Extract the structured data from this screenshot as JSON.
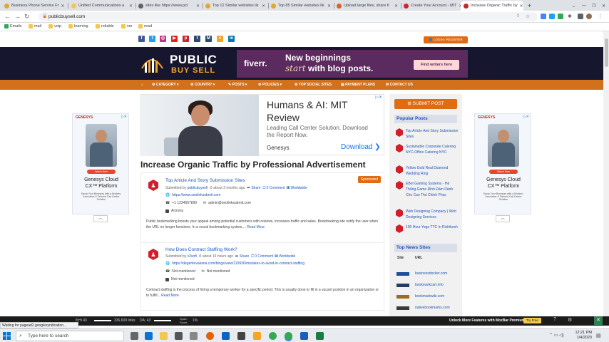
{
  "browser": {
    "tabs": [
      {
        "label": "Business Phone Service Fr",
        "color": "#e4a72b"
      },
      {
        "label": "Unified Communications a",
        "color": "#f6c64c"
      },
      {
        "label": "sites like https://www.pcl",
        "color": "#5f6368"
      },
      {
        "label": "Top 12 Similar websites lik",
        "color": "#e4a72b"
      },
      {
        "label": "Top 85 Similar websites lik",
        "color": "#e4a72b"
      },
      {
        "label": "Upload large files, share fi",
        "color": "#d9602b"
      },
      {
        "label": "Create Your Account - MIT",
        "color": "#c22b2b"
      },
      {
        "label": "Increase Organic Traffic by",
        "color": "#c22b2b"
      }
    ],
    "url": "publicbuysell.com",
    "bookmarks": [
      "Emails",
      "mail",
      "voip",
      "learning",
      "reliable",
      "sm",
      "read"
    ]
  },
  "header": {
    "login_label": "LOGIN / REGISTER",
    "logo_public": "PUBLIC",
    "logo_buysell": "BUY SELL",
    "fiverr_ad": {
      "brand": "fiverr.",
      "line1": "New beginnings",
      "line2_italic": "start",
      "line2_rest": "with blog posts.",
      "cta": "Find writers here",
      "adchoice": "▷✕"
    }
  },
  "menu": [
    "CATEGORY ▾",
    "COUNTRY ▾",
    "POSTS ▾",
    "POLICIES ▾",
    "TOP SOCIAL SITES",
    "PAYMENT PLANS",
    "CONTACT US"
  ],
  "side_ads": {
    "brand": "GENESYS",
    "pill": "Watch Now",
    "title1": "Genesys Cloud",
    "title2": "CX™ Platform",
    "desc": "Equip Your Business with a Modern, Innovative & Tailored Call Center Solution",
    "adchoice": "▷✕"
  },
  "top_ad": {
    "title1": "Humans & AI: MIT",
    "title2": "Review",
    "desc1": "Leading Call Center Solution. Download",
    "desc2": "the Report Now.",
    "brand": "Genesys",
    "download": "Download  ❯",
    "adchoice": "▷✕"
  },
  "page_title": "Increase Organic Traffic by Professional Advertisement",
  "listings": [
    {
      "title": "Top Article And Story Submission Sites",
      "meta_prefix": "Submitted by",
      "user": "publicbuysell",
      "time": "about 2 months ago",
      "share": "Share",
      "comments": "0 Comment",
      "scope": "Worldwide",
      "url": "https://www.seolinksubmit.com",
      "phone": "+1 1234567890",
      "email": "admin@seolinksubmit.com",
      "location": "Arizona",
      "description": "Public bookmarking boosts your appeal among potential customers with reviews, increases traffic and sales. Bookmarking site notify the user when the URL no longer functions. In a social bookmarking system,...",
      "read_more": "Read More",
      "sponsored": "Sponsored"
    },
    {
      "title": "How Does Contract Staffing Work?",
      "meta_prefix": "Submitted by",
      "user": "v2soft",
      "time": "about 16 hours ago",
      "share": "Share",
      "comments": "0 Comment",
      "scope": "Worldwide",
      "url": "https://degentevakana.com/blogs/view/119936/mistakes-to-avoid-in-contract-staffing",
      "phone": "Not mentioned",
      "email": "Not mentioned",
      "location": "Not mentioned",
      "description": "Contract staffing is the process of hiring a temporary worker for a specific period. This is usually done to fill in a vacant position in an organization or to fulfill...",
      "read_more": "Read More"
    }
  ],
  "sidebar": {
    "submit_label": "SUBMIT POST",
    "popular_heading": "Popular Posts",
    "popular": [
      "Top Article And Story Submission Sites",
      "Sustainable Corporate Catering NYC-Office Catering NYC",
      "Yellow Gold Real Diamond Wedding Ring",
      "EBet Gaming Systems - Hệ Thống Game Đỉnh Đám Dành Cho Cao Thủ Chinh Phục",
      "Web Designing Company | Web Designing Services",
      "100 Hour Yoga TTC In Rishikesh"
    ],
    "top_news_heading": "Top News Sites",
    "table_headers": [
      "Site",
      "URL"
    ],
    "news_sites": [
      {
        "url": "businessdocker.com",
        "color": "#1e4f9c"
      },
      {
        "url": "bookmarkcart.info",
        "color": "#2a3c5c"
      },
      {
        "url": "bookmarkwiki.com",
        "color": "#a06a1c"
      },
      {
        "url": "nativebookmarks.com",
        "color": "#3a3a3a"
      }
    ]
  },
  "status": {
    "waiting": "Waiting for pagead2.googlesyndication...",
    "media_left": "8:Hi 43",
    "media_count": "336,609 links",
    "media_da": "DA: 43",
    "media_spam": "Spam Score",
    "media_pct": "1%",
    "promo": "Unlock More Features with MozBar Premium",
    "promo_btn": "Try Free"
  },
  "taskbar": {
    "search_placeholder": "Type here to search",
    "time": "12:21 PM",
    "date": "1/4/2023"
  }
}
